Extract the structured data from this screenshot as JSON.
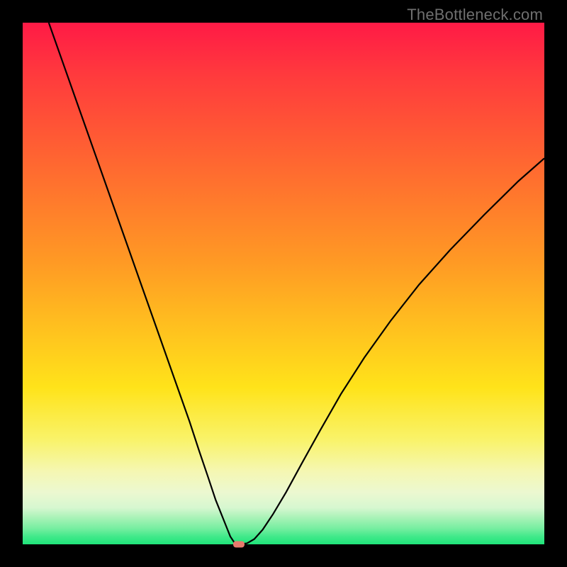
{
  "watermark": "TheBottleneck.com",
  "chart_data": {
    "type": "line",
    "title": "",
    "xlabel": "",
    "ylabel": "",
    "xlim": [
      0,
      1
    ],
    "ylim": [
      0,
      1
    ],
    "series": [
      {
        "name": "curve",
        "x": [
          0.05,
          0.08,
          0.11,
          0.14,
          0.17,
          0.2,
          0.23,
          0.26,
          0.29,
          0.32,
          0.338,
          0.355,
          0.37,
          0.38,
          0.39,
          0.398,
          0.406,
          0.414,
          0.43,
          0.444,
          0.46,
          0.48,
          0.505,
          0.535,
          0.57,
          0.61,
          0.655,
          0.705,
          0.76,
          0.82,
          0.885,
          0.95,
          1.0
        ],
        "values": [
          1.0,
          0.915,
          0.83,
          0.745,
          0.66,
          0.575,
          0.49,
          0.405,
          0.32,
          0.235,
          0.18,
          0.13,
          0.085,
          0.06,
          0.035,
          0.015,
          0.003,
          0.0,
          0.002,
          0.01,
          0.028,
          0.058,
          0.1,
          0.155,
          0.218,
          0.288,
          0.358,
          0.428,
          0.498,
          0.565,
          0.632,
          0.696,
          0.74
        ]
      }
    ],
    "marker": {
      "x": 0.414,
      "y": 0.0
    },
    "background_gradient": {
      "top": "#ff1a46",
      "mid": "#ffd31a",
      "bottom": "#1fe47a"
    }
  }
}
